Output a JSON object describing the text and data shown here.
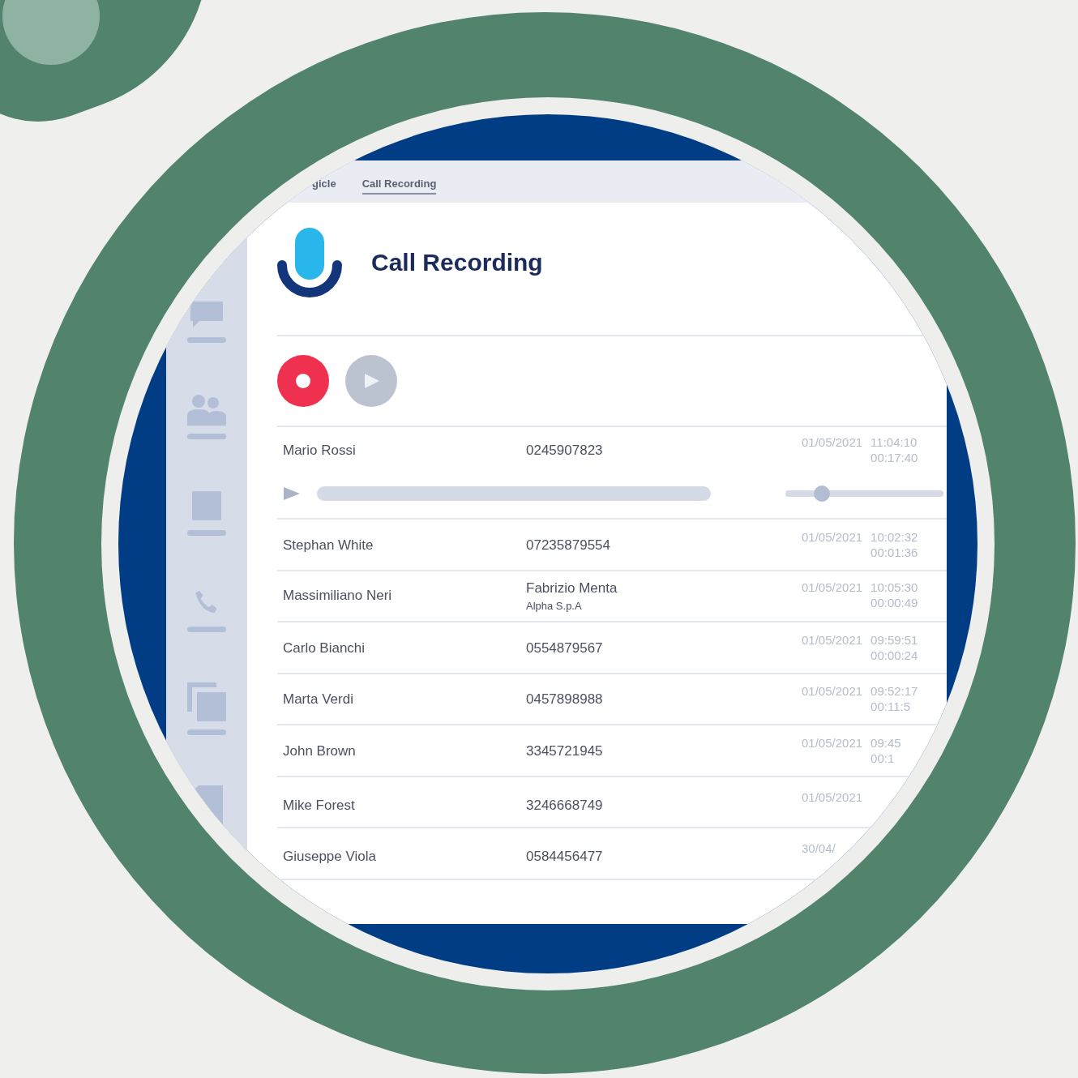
{
  "tabs": [
    {
      "label": "gicle",
      "selected": false
    },
    {
      "label": "Call Recording",
      "selected": true
    }
  ],
  "header": {
    "title": "Call Recording"
  },
  "recordings": [
    {
      "name": "Mario Rossi",
      "number": "0245907823",
      "date": "01/05/2021",
      "time": "11:04:10",
      "duration": "00:17:40",
      "expanded": true,
      "volume": {
        "level": 0.23
      }
    },
    {
      "name": "Stephan White",
      "number": "07235879554",
      "date": "01/05/2021",
      "time": "10:02:32",
      "duration": "00:01:36",
      "expanded": false
    },
    {
      "name": "Massimiliano Neri",
      "number": "Fabrizio Menta",
      "company": "Alpha S.p.A",
      "date": "01/05/2021",
      "time": "10:05:30",
      "duration": "00:00:49",
      "expanded": false
    },
    {
      "name": "Carlo Bianchi",
      "number": "0554879567",
      "date": "01/05/2021",
      "time": "09:59:51",
      "duration": "00:00:24",
      "expanded": false
    },
    {
      "name": "Marta Verdi",
      "number": "0457898988",
      "date": "01/05/2021",
      "time": "09:52:17",
      "duration": "00:11:5",
      "expanded": false
    },
    {
      "name": "John Brown",
      "number": "3345721945",
      "date": "01/05/2021",
      "time": "09:45",
      "duration": "00:1",
      "expanded": false
    },
    {
      "name": "Mike Forest",
      "number": "3246668749",
      "date": "01/05/2021",
      "expanded": false
    },
    {
      "name": "Giuseppe Viola",
      "number": "0584456477",
      "date": "30/04/",
      "expanded": false
    }
  ]
}
